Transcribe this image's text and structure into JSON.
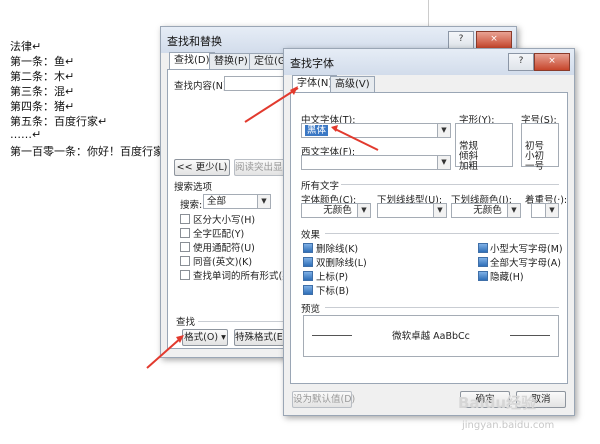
{
  "document": {
    "lines": [
      "法律↵",
      "第一条：鱼↵",
      "第二条：木↵",
      "第三条：混↵",
      "第四条：猪↵",
      "第五条：百度行家↵",
      "……↵",
      "第一百零一条：你好！百度行家↵"
    ]
  },
  "find_dialog": {
    "title": "查找和替换",
    "help_btn": "?",
    "close_btn": "×",
    "tabs": [
      "查找(D)",
      "替换(P)",
      "定位(G)"
    ],
    "find_label": "查找内容(N):",
    "less_btn": "<< 更少(L)",
    "highlight_btn": "阅读突出显示",
    "search_options": "搜索选项",
    "search_label": "搜索:",
    "search_value": "全部",
    "options": [
      "区分大小写(H)",
      "全字匹配(Y)",
      "使用通配符(U)",
      "同音(英文)(K)",
      "查找单词的所有形式(英文)(W)"
    ],
    "find_section": "查找",
    "format_btn": "格式(O) ▾",
    "special_btn": "特殊格式(E) ▾"
  },
  "font_dialog": {
    "title": "查找字体",
    "help_btn": "?",
    "close_btn": "×",
    "tabs": [
      "字体(N)",
      "高级(V)"
    ],
    "cn_font_label": "中文字体(T):",
    "cn_font_value": "黑体",
    "style_label": "字形(Y):",
    "style_items": [
      "常规",
      "倾斜",
      "加粗"
    ],
    "size_label": "字号(S):",
    "size_items": [
      "初号",
      "小初",
      "一号"
    ],
    "west_font_label": "西文字体(F):",
    "all_text": "所有文字",
    "font_color_label": "字体颜色(C):",
    "font_color_value": "无颜色",
    "underline_label": "下划线线型(U):",
    "underline_color_label": "下划线颜色(I):",
    "underline_color_value": "无颜色",
    "emphasis_label": "着重号(·):",
    "effects": "效果",
    "effects_left": [
      "删除线(K)",
      "双删除线(L)",
      "上标(P)",
      "下标(B)"
    ],
    "effects_right": [
      "小型大写字母(M)",
      "全部大写字母(A)",
      "隐藏(H)"
    ],
    "preview": "预览",
    "preview_text": "微软卓越  AaBbCc",
    "default_btn": "设为默认值(D)",
    "ok_btn": "确定",
    "cancel_btn": "取消"
  },
  "watermark": "Baidu经验",
  "watermark_url": "jingyan.baidu.com",
  "colors": {
    "arrow": "#e23a2e",
    "accent_blue": "#2f6fb8"
  }
}
